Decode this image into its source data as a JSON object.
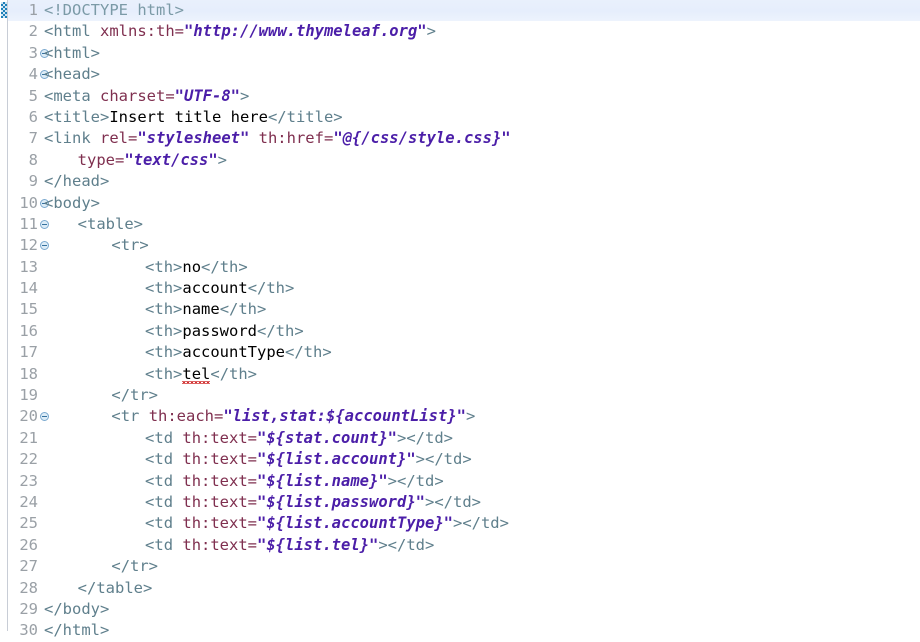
{
  "editor": {
    "name": "eclipse-html-editor",
    "language": "HTML/Thymeleaf",
    "current_line": 1,
    "total_lines": 30,
    "colors": {
      "background": "#ffffff",
      "current_line_highlight": "#e8effc",
      "line_number": "#9aa0a6",
      "tag": "#5f7f8c",
      "doctype": "#7b9aa6",
      "attribute_name": "#7f2f4f",
      "attribute_value": "#4b1ea8",
      "text_content": "#000000",
      "error_squiggle": "#d03030",
      "fold_marker": "#7aa9cf",
      "gutter_separator": "#c8cdd6",
      "overview_marker": "#1e7fb8"
    },
    "gutter": {
      "marker_icon": "annotation-marker-icon",
      "fold_marker_icon": "collapse-fold-icon",
      "folded_lines": [
        3,
        4,
        10,
        11,
        12,
        20
      ]
    }
  },
  "lines": [
    {
      "n": "1",
      "fold": false,
      "indent": 0,
      "tokens": [
        {
          "t": "doctype",
          "v": "<!DOCTYPE html>"
        }
      ]
    },
    {
      "n": "2",
      "fold": false,
      "indent": 0,
      "tokens": [
        {
          "t": "tag",
          "v": "<html "
        },
        {
          "t": "attr",
          "v": "xmlns:th="
        },
        {
          "t": "val",
          "v": "\"http://www.thymeleaf.org\""
        },
        {
          "t": "tag",
          "v": ">"
        }
      ]
    },
    {
      "n": "3",
      "fold": true,
      "indent": 0,
      "tokens": [
        {
          "t": "tag",
          "v": "<html>"
        }
      ]
    },
    {
      "n": "4",
      "fold": true,
      "indent": 0,
      "tokens": [
        {
          "t": "tag",
          "v": "<head>"
        }
      ]
    },
    {
      "n": "5",
      "fold": false,
      "indent": 0,
      "tokens": [
        {
          "t": "tag",
          "v": "<meta "
        },
        {
          "t": "attr",
          "v": "charset="
        },
        {
          "t": "val",
          "v": "\"UTF-8\""
        },
        {
          "t": "tag",
          "v": ">"
        }
      ]
    },
    {
      "n": "6",
      "fold": false,
      "indent": 0,
      "tokens": [
        {
          "t": "tag",
          "v": "<title>"
        },
        {
          "t": "text",
          "v": "Insert title here"
        },
        {
          "t": "tag",
          "v": "</title>"
        }
      ]
    },
    {
      "n": "7",
      "fold": false,
      "indent": 0,
      "tokens": [
        {
          "t": "tag",
          "v": "<link "
        },
        {
          "t": "attr",
          "v": "rel="
        },
        {
          "t": "val",
          "v": "\"stylesheet\""
        },
        {
          "t": "attr",
          "v": " th:href="
        },
        {
          "t": "val",
          "v": "\"@{/css/style.css}\""
        }
      ]
    },
    {
      "n": "8",
      "fold": false,
      "indent": 4,
      "tokens": [
        {
          "t": "attr",
          "v": "type="
        },
        {
          "t": "val",
          "v": "\"text/css\""
        },
        {
          "t": "tag",
          "v": ">"
        }
      ]
    },
    {
      "n": "9",
      "fold": false,
      "indent": 0,
      "tokens": [
        {
          "t": "tag",
          "v": "</head>"
        }
      ]
    },
    {
      "n": "10",
      "fold": true,
      "indent": 0,
      "tokens": [
        {
          "t": "tag",
          "v": "<body>"
        }
      ]
    },
    {
      "n": "11",
      "fold": true,
      "indent": 4,
      "tokens": [
        {
          "t": "tag",
          "v": "<table>"
        }
      ]
    },
    {
      "n": "12",
      "fold": true,
      "indent": 8,
      "tokens": [
        {
          "t": "tag",
          "v": "<tr>"
        }
      ]
    },
    {
      "n": "13",
      "fold": false,
      "indent": 12,
      "tokens": [
        {
          "t": "tag",
          "v": "<th>"
        },
        {
          "t": "text",
          "v": "no"
        },
        {
          "t": "tag",
          "v": "</th>"
        }
      ]
    },
    {
      "n": "14",
      "fold": false,
      "indent": 12,
      "tokens": [
        {
          "t": "tag",
          "v": "<th>"
        },
        {
          "t": "text",
          "v": "account"
        },
        {
          "t": "tag",
          "v": "</th>"
        }
      ]
    },
    {
      "n": "15",
      "fold": false,
      "indent": 12,
      "tokens": [
        {
          "t": "tag",
          "v": "<th>"
        },
        {
          "t": "text",
          "v": "name"
        },
        {
          "t": "tag",
          "v": "</th>"
        }
      ]
    },
    {
      "n": "16",
      "fold": false,
      "indent": 12,
      "tokens": [
        {
          "t": "tag",
          "v": "<th>"
        },
        {
          "t": "text",
          "v": "password"
        },
        {
          "t": "tag",
          "v": "</th>"
        }
      ]
    },
    {
      "n": "17",
      "fold": false,
      "indent": 12,
      "tokens": [
        {
          "t": "tag",
          "v": "<th>"
        },
        {
          "t": "text",
          "v": "accountType"
        },
        {
          "t": "tag",
          "v": "</th>"
        }
      ]
    },
    {
      "n": "18",
      "fold": false,
      "indent": 12,
      "tokens": [
        {
          "t": "tag",
          "v": "<th>"
        },
        {
          "t": "text-error",
          "v": "tel"
        },
        {
          "t": "tag",
          "v": "</th>"
        }
      ]
    },
    {
      "n": "19",
      "fold": false,
      "indent": 8,
      "tokens": [
        {
          "t": "tag",
          "v": "</tr>"
        }
      ]
    },
    {
      "n": "20",
      "fold": true,
      "indent": 8,
      "tokens": [
        {
          "t": "tag",
          "v": "<tr "
        },
        {
          "t": "attr",
          "v": "th:each="
        },
        {
          "t": "val",
          "v": "\"list,stat:${accountList}\""
        },
        {
          "t": "tag",
          "v": ">"
        }
      ]
    },
    {
      "n": "21",
      "fold": false,
      "indent": 12,
      "tokens": [
        {
          "t": "tag",
          "v": "<td "
        },
        {
          "t": "attr",
          "v": "th:text="
        },
        {
          "t": "val",
          "v": "\"${stat.count}\""
        },
        {
          "t": "tag",
          "v": "></td>"
        }
      ]
    },
    {
      "n": "22",
      "fold": false,
      "indent": 12,
      "tokens": [
        {
          "t": "tag",
          "v": "<td "
        },
        {
          "t": "attr",
          "v": "th:text="
        },
        {
          "t": "val",
          "v": "\"${list.account}\""
        },
        {
          "t": "tag",
          "v": "></td>"
        }
      ]
    },
    {
      "n": "23",
      "fold": false,
      "indent": 12,
      "tokens": [
        {
          "t": "tag",
          "v": "<td "
        },
        {
          "t": "attr",
          "v": "th:text="
        },
        {
          "t": "val",
          "v": "\"${list.name}\""
        },
        {
          "t": "tag",
          "v": "></td>"
        }
      ]
    },
    {
      "n": "24",
      "fold": false,
      "indent": 12,
      "tokens": [
        {
          "t": "tag",
          "v": "<td "
        },
        {
          "t": "attr",
          "v": "th:text="
        },
        {
          "t": "val",
          "v": "\"${list.password}\""
        },
        {
          "t": "tag",
          "v": "></td>"
        }
      ]
    },
    {
      "n": "25",
      "fold": false,
      "indent": 12,
      "tokens": [
        {
          "t": "tag",
          "v": "<td "
        },
        {
          "t": "attr",
          "v": "th:text="
        },
        {
          "t": "val",
          "v": "\"${list.accountType}\""
        },
        {
          "t": "tag",
          "v": "></td>"
        }
      ]
    },
    {
      "n": "26",
      "fold": false,
      "indent": 12,
      "tokens": [
        {
          "t": "tag",
          "v": "<td "
        },
        {
          "t": "attr",
          "v": "th:text="
        },
        {
          "t": "val",
          "v": "\"${list.tel}\""
        },
        {
          "t": "tag",
          "v": "></td>"
        }
      ]
    },
    {
      "n": "27",
      "fold": false,
      "indent": 8,
      "tokens": [
        {
          "t": "tag",
          "v": "</tr>"
        }
      ]
    },
    {
      "n": "28",
      "fold": false,
      "indent": 4,
      "tokens": [
        {
          "t": "tag",
          "v": "</table>"
        }
      ]
    },
    {
      "n": "29",
      "fold": false,
      "indent": 0,
      "tokens": [
        {
          "t": "tag",
          "v": "</body>"
        }
      ]
    },
    {
      "n": "30",
      "fold": false,
      "indent": 0,
      "tokens": [
        {
          "t": "tag",
          "v": "</html>"
        }
      ]
    }
  ]
}
